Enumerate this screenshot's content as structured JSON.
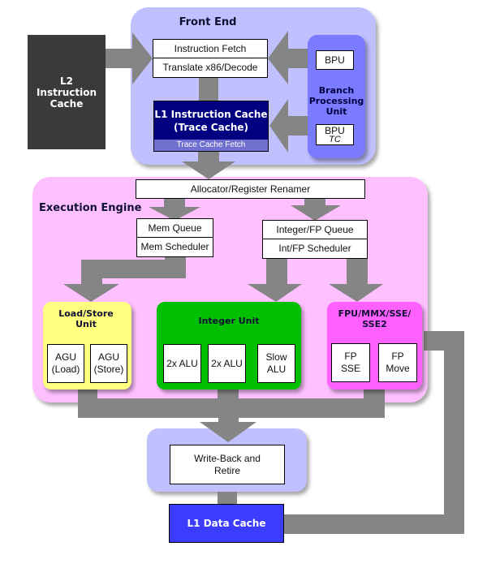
{
  "l2_cache": {
    "label": "L2 Instruction Cache",
    "color": "#3a3a3a"
  },
  "front_end": {
    "title": "Front End",
    "color": "#c0c0ff",
    "instruction_fetch": "Instruction Fetch",
    "translate_decode": "Translate x86/Decode",
    "l1_icache": {
      "line1": "L1 Instruction Cache",
      "line2": "(Trace Cache)",
      "color": "#000080"
    },
    "trace_cache_fetch": {
      "label": "Trace Cache Fetch",
      "color": "#7070d0"
    },
    "bpu_unit": {
      "title": "Branch Processing Unit",
      "color": "#7b7bff",
      "bpu": "BPU",
      "bpu_tc": {
        "line1": "BPU",
        "line2": "TC"
      }
    }
  },
  "execution_engine": {
    "title": "Execution Engine",
    "color": "#ffc0ff",
    "allocator": "Allocator/Register Renamer",
    "mem_queue": "Mem Queue",
    "mem_scheduler": "Mem Scheduler",
    "int_fp_queue": "Integer/FP Queue",
    "int_fp_scheduler": "Int/FP Scheduler",
    "load_store": {
      "title": "Load/Store Unit",
      "color": "#ffff80",
      "agu_load": {
        "line1": "AGU",
        "line2": "(Load)"
      },
      "agu_store": {
        "line1": "AGU",
        "line2": "(Store)"
      }
    },
    "integer_unit": {
      "title": "Integer Unit",
      "color": "#00c000",
      "alu1": "2x ALU",
      "alu2": "2x ALU",
      "slow_alu": {
        "line1": "Slow",
        "line2": "ALU"
      }
    },
    "fpu": {
      "title_line1": "FPU/MMX/SSE/",
      "title_line2": "SSE2",
      "color": "#ff60ff",
      "fp_sse": {
        "line1": "FP",
        "line2": "SSE"
      },
      "fp_move": {
        "line1": "FP",
        "line2": "Move"
      }
    }
  },
  "write_back": {
    "line1": "Write-Back and",
    "line2": "Retire",
    "panel_color": "#c0c0ff"
  },
  "l1_dcache": {
    "label": "L1 Data Cache",
    "color": "#3c3cff"
  },
  "arrow_color": "#858585"
}
